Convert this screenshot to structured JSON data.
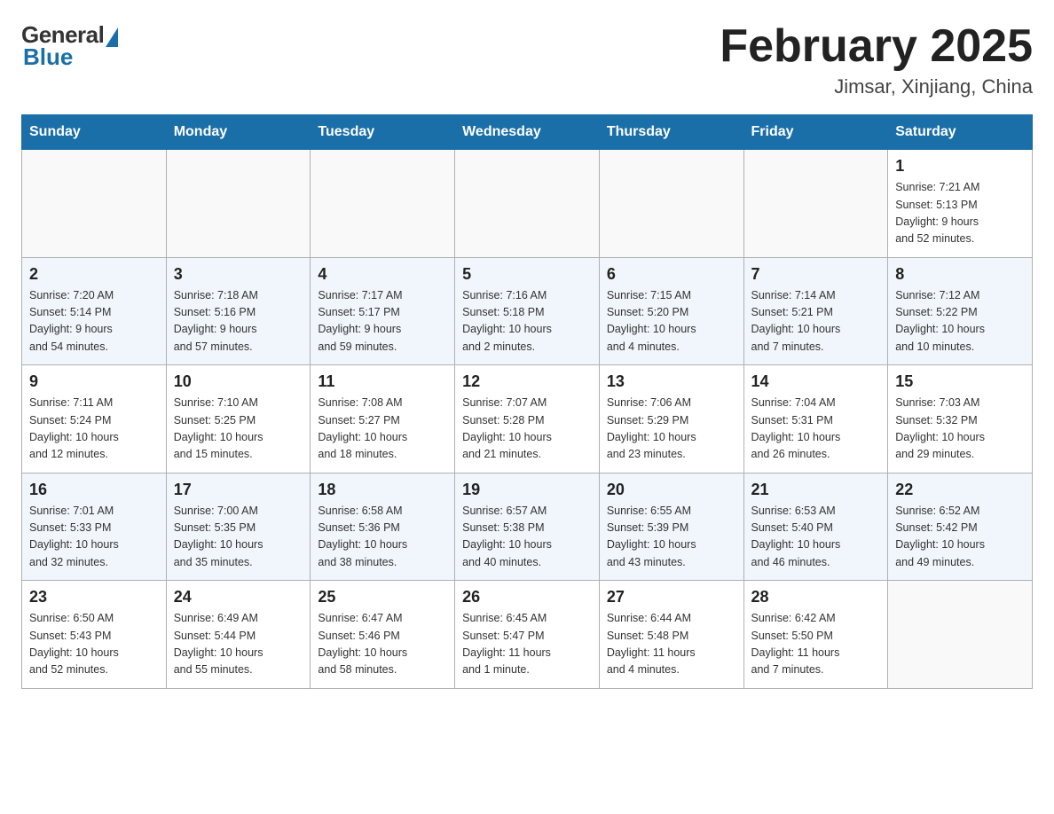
{
  "header": {
    "logo": {
      "general": "General",
      "blue": "Blue"
    },
    "title": "February 2025",
    "location": "Jimsar, Xinjiang, China"
  },
  "weekdays": [
    "Sunday",
    "Monday",
    "Tuesday",
    "Wednesday",
    "Thursday",
    "Friday",
    "Saturday"
  ],
  "weeks": [
    [
      {
        "day": "",
        "info": ""
      },
      {
        "day": "",
        "info": ""
      },
      {
        "day": "",
        "info": ""
      },
      {
        "day": "",
        "info": ""
      },
      {
        "day": "",
        "info": ""
      },
      {
        "day": "",
        "info": ""
      },
      {
        "day": "1",
        "info": "Sunrise: 7:21 AM\nSunset: 5:13 PM\nDaylight: 9 hours\nand 52 minutes."
      }
    ],
    [
      {
        "day": "2",
        "info": "Sunrise: 7:20 AM\nSunset: 5:14 PM\nDaylight: 9 hours\nand 54 minutes."
      },
      {
        "day": "3",
        "info": "Sunrise: 7:18 AM\nSunset: 5:16 PM\nDaylight: 9 hours\nand 57 minutes."
      },
      {
        "day": "4",
        "info": "Sunrise: 7:17 AM\nSunset: 5:17 PM\nDaylight: 9 hours\nand 59 minutes."
      },
      {
        "day": "5",
        "info": "Sunrise: 7:16 AM\nSunset: 5:18 PM\nDaylight: 10 hours\nand 2 minutes."
      },
      {
        "day": "6",
        "info": "Sunrise: 7:15 AM\nSunset: 5:20 PM\nDaylight: 10 hours\nand 4 minutes."
      },
      {
        "day": "7",
        "info": "Sunrise: 7:14 AM\nSunset: 5:21 PM\nDaylight: 10 hours\nand 7 minutes."
      },
      {
        "day": "8",
        "info": "Sunrise: 7:12 AM\nSunset: 5:22 PM\nDaylight: 10 hours\nand 10 minutes."
      }
    ],
    [
      {
        "day": "9",
        "info": "Sunrise: 7:11 AM\nSunset: 5:24 PM\nDaylight: 10 hours\nand 12 minutes."
      },
      {
        "day": "10",
        "info": "Sunrise: 7:10 AM\nSunset: 5:25 PM\nDaylight: 10 hours\nand 15 minutes."
      },
      {
        "day": "11",
        "info": "Sunrise: 7:08 AM\nSunset: 5:27 PM\nDaylight: 10 hours\nand 18 minutes."
      },
      {
        "day": "12",
        "info": "Sunrise: 7:07 AM\nSunset: 5:28 PM\nDaylight: 10 hours\nand 21 minutes."
      },
      {
        "day": "13",
        "info": "Sunrise: 7:06 AM\nSunset: 5:29 PM\nDaylight: 10 hours\nand 23 minutes."
      },
      {
        "day": "14",
        "info": "Sunrise: 7:04 AM\nSunset: 5:31 PM\nDaylight: 10 hours\nand 26 minutes."
      },
      {
        "day": "15",
        "info": "Sunrise: 7:03 AM\nSunset: 5:32 PM\nDaylight: 10 hours\nand 29 minutes."
      }
    ],
    [
      {
        "day": "16",
        "info": "Sunrise: 7:01 AM\nSunset: 5:33 PM\nDaylight: 10 hours\nand 32 minutes."
      },
      {
        "day": "17",
        "info": "Sunrise: 7:00 AM\nSunset: 5:35 PM\nDaylight: 10 hours\nand 35 minutes."
      },
      {
        "day": "18",
        "info": "Sunrise: 6:58 AM\nSunset: 5:36 PM\nDaylight: 10 hours\nand 38 minutes."
      },
      {
        "day": "19",
        "info": "Sunrise: 6:57 AM\nSunset: 5:38 PM\nDaylight: 10 hours\nand 40 minutes."
      },
      {
        "day": "20",
        "info": "Sunrise: 6:55 AM\nSunset: 5:39 PM\nDaylight: 10 hours\nand 43 minutes."
      },
      {
        "day": "21",
        "info": "Sunrise: 6:53 AM\nSunset: 5:40 PM\nDaylight: 10 hours\nand 46 minutes."
      },
      {
        "day": "22",
        "info": "Sunrise: 6:52 AM\nSunset: 5:42 PM\nDaylight: 10 hours\nand 49 minutes."
      }
    ],
    [
      {
        "day": "23",
        "info": "Sunrise: 6:50 AM\nSunset: 5:43 PM\nDaylight: 10 hours\nand 52 minutes."
      },
      {
        "day": "24",
        "info": "Sunrise: 6:49 AM\nSunset: 5:44 PM\nDaylight: 10 hours\nand 55 minutes."
      },
      {
        "day": "25",
        "info": "Sunrise: 6:47 AM\nSunset: 5:46 PM\nDaylight: 10 hours\nand 58 minutes."
      },
      {
        "day": "26",
        "info": "Sunrise: 6:45 AM\nSunset: 5:47 PM\nDaylight: 11 hours\nand 1 minute."
      },
      {
        "day": "27",
        "info": "Sunrise: 6:44 AM\nSunset: 5:48 PM\nDaylight: 11 hours\nand 4 minutes."
      },
      {
        "day": "28",
        "info": "Sunrise: 6:42 AM\nSunset: 5:50 PM\nDaylight: 11 hours\nand 7 minutes."
      },
      {
        "day": "",
        "info": ""
      }
    ]
  ]
}
